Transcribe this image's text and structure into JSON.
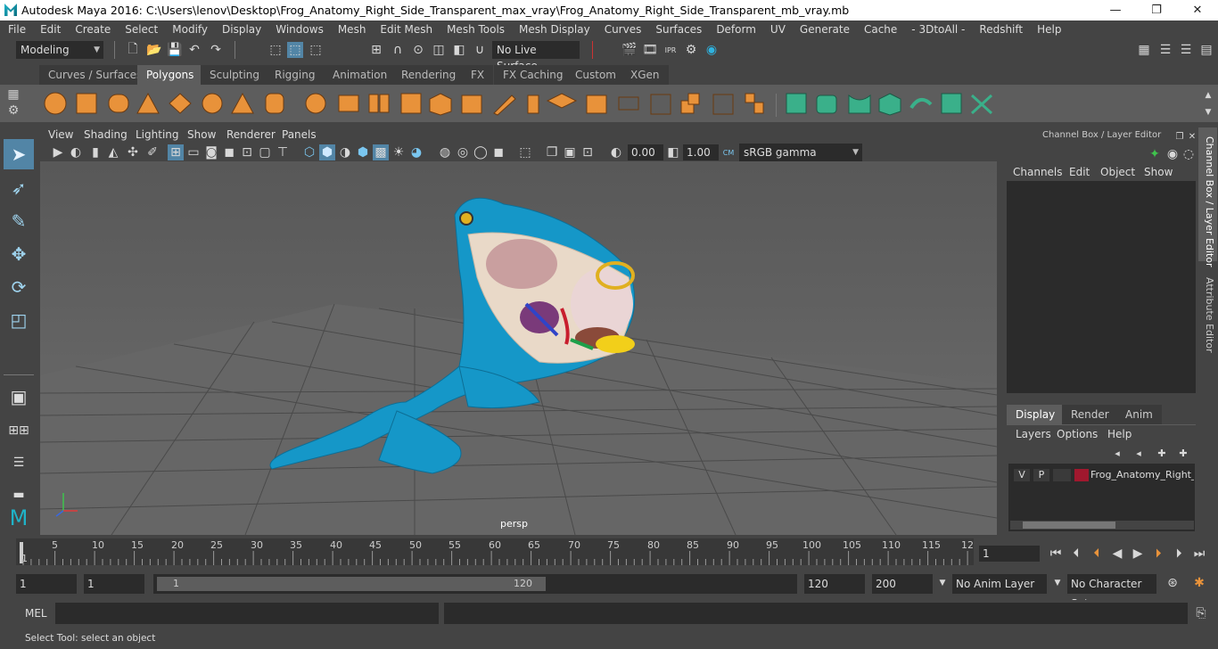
{
  "window": {
    "title": "Autodesk Maya 2016: C:\\Users\\lenov\\Desktop\\Frog_Anatomy_Right_Side_Transparent_max_vray\\Frog_Anatomy_Right_Side_Transparent_mb_vray.mb",
    "minimize": "—",
    "restore": "❐",
    "close": "✕"
  },
  "menubar": [
    "File",
    "Edit",
    "Create",
    "Select",
    "Modify",
    "Display",
    "Windows",
    "Mesh",
    "Edit Mesh",
    "Mesh Tools",
    "Mesh Display",
    "Curves",
    "Surfaces",
    "Deform",
    "UV",
    "Generate",
    "Cache",
    "- 3DtoAll -",
    "Redshift",
    "Help"
  ],
  "statusline": {
    "mode": "Modeling",
    "live_surface": "No Live Surface"
  },
  "shelf_tabs": [
    "Curves / Surfaces",
    "Polygons",
    "Sculpting",
    "Rigging",
    "Animation",
    "Rendering",
    "FX",
    "FX Caching",
    "Custom",
    "XGen"
  ],
  "active_shelf_tab": "Polygons",
  "panel_menu": [
    "View",
    "Shading",
    "Lighting",
    "Show",
    "Renderer",
    "Panels"
  ],
  "panel_tools": {
    "exposure": "0.00",
    "gamma": "1.00",
    "color_space": "sRGB gamma"
  },
  "viewport": {
    "camera_label": "persp"
  },
  "right_panel": {
    "title": "Channel Box / Layer Editor",
    "channel_menu": [
      "Channels",
      "Edit",
      "Object",
      "Show"
    ],
    "tabs": [
      "Display",
      "Render",
      "Anim"
    ],
    "active_tab": "Display",
    "layer_menu": [
      "Layers",
      "Options",
      "Help"
    ],
    "layer": {
      "v": "V",
      "p": "P",
      "name": "Frog_Anatomy_Right_S",
      "color": "#a0182e"
    },
    "side_tabs": [
      "Channel Box / Layer Editor",
      "Attribute Editor"
    ]
  },
  "timeline": {
    "labels": [
      "5",
      "10",
      "15",
      "20",
      "25",
      "30",
      "35",
      "40",
      "45",
      "50",
      "55",
      "60",
      "65",
      "70",
      "75",
      "80",
      "85",
      "90",
      "95",
      "100",
      "105",
      "110",
      "115",
      "12"
    ],
    "start_marker": "1",
    "current_frame": "1"
  },
  "range": {
    "start": "1",
    "start2": "1",
    "slider_start": "1",
    "slider_end": "120",
    "end": "120",
    "end2": "200",
    "anim_layer": "No Anim Layer",
    "char_set": "No Character Set"
  },
  "cmd": {
    "label": "MEL"
  },
  "help_line": "Select Tool: select an object",
  "colors": {
    "frog": "#1597c8",
    "accent": "#5285a6"
  }
}
